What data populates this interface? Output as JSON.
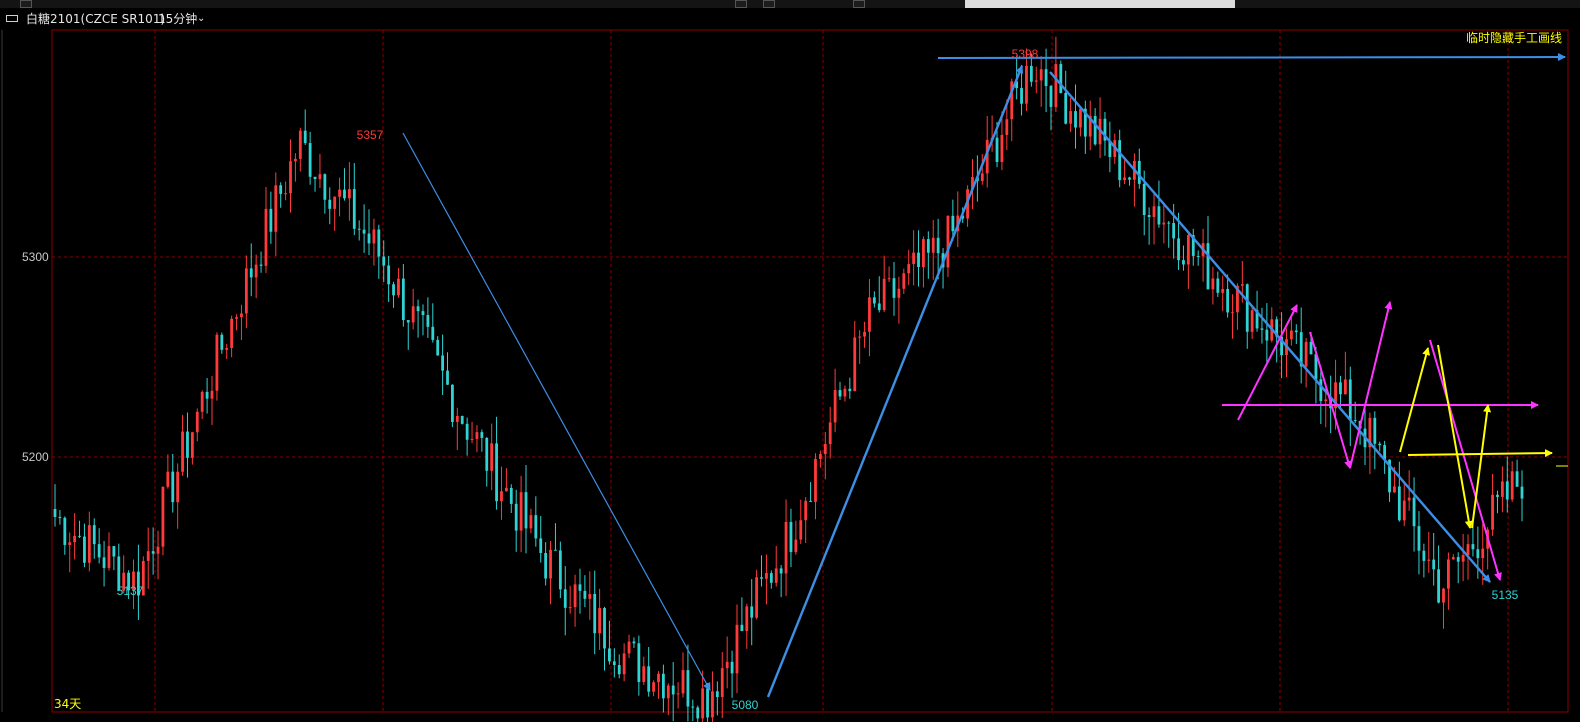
{
  "window": {
    "symbol_label": "白糖2101(CZCE SR101)",
    "period_label": "15分钟",
    "hide_lines_label": "临时隐藏手工画线"
  },
  "colors": {
    "background": "#000000",
    "grid": "#8b0000",
    "up_candle": "#ff3a3a",
    "down_candle": "#2fd3d3",
    "axis_text": "#c8c8c8",
    "trend_blue": "#3d8fe6",
    "pink": "#ff33ff",
    "yellow": "#ffff00"
  },
  "chart_data": {
    "type": "candlestick",
    "instrument": "白糖2101(CZCE SR101)",
    "interval": "15分钟",
    "y_ticks": [
      5300,
      5200
    ],
    "ylim": [
      5080,
      5398
    ],
    "span_label": "34天",
    "annotations": [
      {
        "label": "5137",
        "kind": "low"
      },
      {
        "label": "5357",
        "kind": "high"
      },
      {
        "label": "5080",
        "kind": "low"
      },
      {
        "label": "5398",
        "kind": "high"
      },
      {
        "label": "5135",
        "kind": "low"
      }
    ],
    "swing_path": [
      5170,
      5137,
      5250,
      5357,
      5300,
      5220,
      5150,
      5100,
      5080,
      5160,
      5270,
      5310,
      5398,
      5350,
      5300,
      5260,
      5220,
      5135,
      5190
    ]
  }
}
